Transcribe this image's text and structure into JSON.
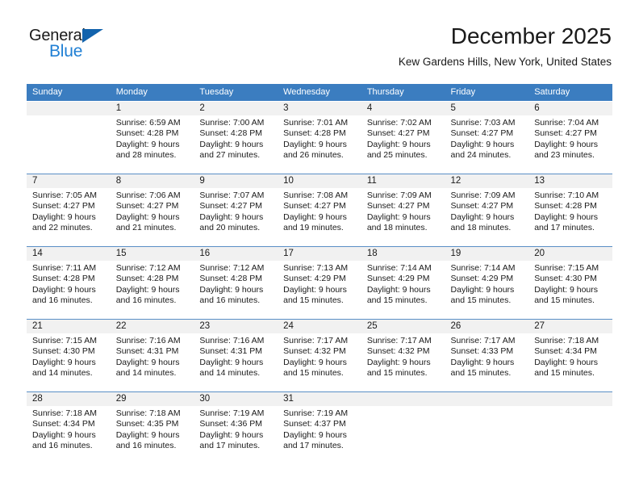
{
  "brand": {
    "name_part1": "General",
    "name_part2": "Blue",
    "triangle_color": "#1263ad",
    "blue_color": "#1f7fd4"
  },
  "header": {
    "month_title": "December 2025",
    "location": "Kew Gardens Hills, New York, United States"
  },
  "theme": {
    "header_row_background": "#3b7dc0",
    "header_row_text": "#ffffff",
    "daynum_background": "#f1f1f1",
    "week_separator": "#5a8fc6",
    "body_text": "#1a1a1a"
  },
  "calendar": {
    "day_headers": [
      "Sunday",
      "Monday",
      "Tuesday",
      "Wednesday",
      "Thursday",
      "Friday",
      "Saturday"
    ],
    "weeks": [
      [
        {
          "day": "",
          "sunrise": "",
          "sunset": "",
          "daylight_line1": "",
          "daylight_line2": ""
        },
        {
          "day": "1",
          "sunrise": "Sunrise: 6:59 AM",
          "sunset": "Sunset: 4:28 PM",
          "daylight_line1": "Daylight: 9 hours",
          "daylight_line2": "and 28 minutes."
        },
        {
          "day": "2",
          "sunrise": "Sunrise: 7:00 AM",
          "sunset": "Sunset: 4:28 PM",
          "daylight_line1": "Daylight: 9 hours",
          "daylight_line2": "and 27 minutes."
        },
        {
          "day": "3",
          "sunrise": "Sunrise: 7:01 AM",
          "sunset": "Sunset: 4:28 PM",
          "daylight_line1": "Daylight: 9 hours",
          "daylight_line2": "and 26 minutes."
        },
        {
          "day": "4",
          "sunrise": "Sunrise: 7:02 AM",
          "sunset": "Sunset: 4:27 PM",
          "daylight_line1": "Daylight: 9 hours",
          "daylight_line2": "and 25 minutes."
        },
        {
          "day": "5",
          "sunrise": "Sunrise: 7:03 AM",
          "sunset": "Sunset: 4:27 PM",
          "daylight_line1": "Daylight: 9 hours",
          "daylight_line2": "and 24 minutes."
        },
        {
          "day": "6",
          "sunrise": "Sunrise: 7:04 AM",
          "sunset": "Sunset: 4:27 PM",
          "daylight_line1": "Daylight: 9 hours",
          "daylight_line2": "and 23 minutes."
        }
      ],
      [
        {
          "day": "7",
          "sunrise": "Sunrise: 7:05 AM",
          "sunset": "Sunset: 4:27 PM",
          "daylight_line1": "Daylight: 9 hours",
          "daylight_line2": "and 22 minutes."
        },
        {
          "day": "8",
          "sunrise": "Sunrise: 7:06 AM",
          "sunset": "Sunset: 4:27 PM",
          "daylight_line1": "Daylight: 9 hours",
          "daylight_line2": "and 21 minutes."
        },
        {
          "day": "9",
          "sunrise": "Sunrise: 7:07 AM",
          "sunset": "Sunset: 4:27 PM",
          "daylight_line1": "Daylight: 9 hours",
          "daylight_line2": "and 20 minutes."
        },
        {
          "day": "10",
          "sunrise": "Sunrise: 7:08 AM",
          "sunset": "Sunset: 4:27 PM",
          "daylight_line1": "Daylight: 9 hours",
          "daylight_line2": "and 19 minutes."
        },
        {
          "day": "11",
          "sunrise": "Sunrise: 7:09 AM",
          "sunset": "Sunset: 4:27 PM",
          "daylight_line1": "Daylight: 9 hours",
          "daylight_line2": "and 18 minutes."
        },
        {
          "day": "12",
          "sunrise": "Sunrise: 7:09 AM",
          "sunset": "Sunset: 4:27 PM",
          "daylight_line1": "Daylight: 9 hours",
          "daylight_line2": "and 18 minutes."
        },
        {
          "day": "13",
          "sunrise": "Sunrise: 7:10 AM",
          "sunset": "Sunset: 4:28 PM",
          "daylight_line1": "Daylight: 9 hours",
          "daylight_line2": "and 17 minutes."
        }
      ],
      [
        {
          "day": "14",
          "sunrise": "Sunrise: 7:11 AM",
          "sunset": "Sunset: 4:28 PM",
          "daylight_line1": "Daylight: 9 hours",
          "daylight_line2": "and 16 minutes."
        },
        {
          "day": "15",
          "sunrise": "Sunrise: 7:12 AM",
          "sunset": "Sunset: 4:28 PM",
          "daylight_line1": "Daylight: 9 hours",
          "daylight_line2": "and 16 minutes."
        },
        {
          "day": "16",
          "sunrise": "Sunrise: 7:12 AM",
          "sunset": "Sunset: 4:28 PM",
          "daylight_line1": "Daylight: 9 hours",
          "daylight_line2": "and 16 minutes."
        },
        {
          "day": "17",
          "sunrise": "Sunrise: 7:13 AM",
          "sunset": "Sunset: 4:29 PM",
          "daylight_line1": "Daylight: 9 hours",
          "daylight_line2": "and 15 minutes."
        },
        {
          "day": "18",
          "sunrise": "Sunrise: 7:14 AM",
          "sunset": "Sunset: 4:29 PM",
          "daylight_line1": "Daylight: 9 hours",
          "daylight_line2": "and 15 minutes."
        },
        {
          "day": "19",
          "sunrise": "Sunrise: 7:14 AM",
          "sunset": "Sunset: 4:29 PM",
          "daylight_line1": "Daylight: 9 hours",
          "daylight_line2": "and 15 minutes."
        },
        {
          "day": "20",
          "sunrise": "Sunrise: 7:15 AM",
          "sunset": "Sunset: 4:30 PM",
          "daylight_line1": "Daylight: 9 hours",
          "daylight_line2": "and 15 minutes."
        }
      ],
      [
        {
          "day": "21",
          "sunrise": "Sunrise: 7:15 AM",
          "sunset": "Sunset: 4:30 PM",
          "daylight_line1": "Daylight: 9 hours",
          "daylight_line2": "and 14 minutes."
        },
        {
          "day": "22",
          "sunrise": "Sunrise: 7:16 AM",
          "sunset": "Sunset: 4:31 PM",
          "daylight_line1": "Daylight: 9 hours",
          "daylight_line2": "and 14 minutes."
        },
        {
          "day": "23",
          "sunrise": "Sunrise: 7:16 AM",
          "sunset": "Sunset: 4:31 PM",
          "daylight_line1": "Daylight: 9 hours",
          "daylight_line2": "and 14 minutes."
        },
        {
          "day": "24",
          "sunrise": "Sunrise: 7:17 AM",
          "sunset": "Sunset: 4:32 PM",
          "daylight_line1": "Daylight: 9 hours",
          "daylight_line2": "and 15 minutes."
        },
        {
          "day": "25",
          "sunrise": "Sunrise: 7:17 AM",
          "sunset": "Sunset: 4:32 PM",
          "daylight_line1": "Daylight: 9 hours",
          "daylight_line2": "and 15 minutes."
        },
        {
          "day": "26",
          "sunrise": "Sunrise: 7:17 AM",
          "sunset": "Sunset: 4:33 PM",
          "daylight_line1": "Daylight: 9 hours",
          "daylight_line2": "and 15 minutes."
        },
        {
          "day": "27",
          "sunrise": "Sunrise: 7:18 AM",
          "sunset": "Sunset: 4:34 PM",
          "daylight_line1": "Daylight: 9 hours",
          "daylight_line2": "and 15 minutes."
        }
      ],
      [
        {
          "day": "28",
          "sunrise": "Sunrise: 7:18 AM",
          "sunset": "Sunset: 4:34 PM",
          "daylight_line1": "Daylight: 9 hours",
          "daylight_line2": "and 16 minutes."
        },
        {
          "day": "29",
          "sunrise": "Sunrise: 7:18 AM",
          "sunset": "Sunset: 4:35 PM",
          "daylight_line1": "Daylight: 9 hours",
          "daylight_line2": "and 16 minutes."
        },
        {
          "day": "30",
          "sunrise": "Sunrise: 7:19 AM",
          "sunset": "Sunset: 4:36 PM",
          "daylight_line1": "Daylight: 9 hours",
          "daylight_line2": "and 17 minutes."
        },
        {
          "day": "31",
          "sunrise": "Sunrise: 7:19 AM",
          "sunset": "Sunset: 4:37 PM",
          "daylight_line1": "Daylight: 9 hours",
          "daylight_line2": "and 17 minutes."
        },
        {
          "day": "",
          "sunrise": "",
          "sunset": "",
          "daylight_line1": "",
          "daylight_line2": ""
        },
        {
          "day": "",
          "sunrise": "",
          "sunset": "",
          "daylight_line1": "",
          "daylight_line2": ""
        },
        {
          "day": "",
          "sunrise": "",
          "sunset": "",
          "daylight_line1": "",
          "daylight_line2": ""
        }
      ]
    ]
  }
}
